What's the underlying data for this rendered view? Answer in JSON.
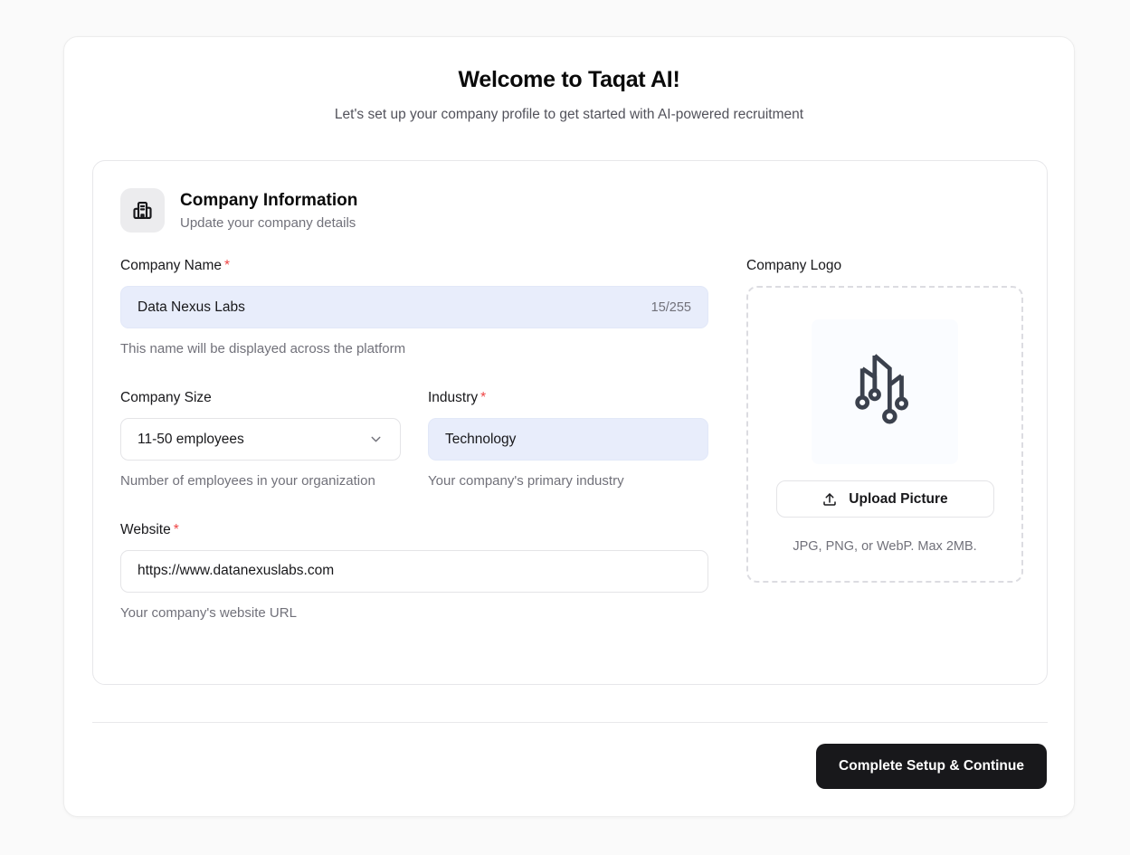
{
  "header": {
    "title": "Welcome to Taqat AI!",
    "subtitle": "Let's set up your company profile to get started with AI-powered recruitment"
  },
  "section": {
    "title": "Company Information",
    "subtitle": "Update your company details",
    "icon": "building-icon"
  },
  "form": {
    "company_name": {
      "label": "Company Name",
      "required": "*",
      "value": "Data Nexus Labs",
      "counter": "15/255",
      "helper": "This name will be displayed across the platform"
    },
    "company_size": {
      "label": "Company Size",
      "value": "11-50 employees",
      "helper": "Number of employees in your organization",
      "icon": "chevron-down-icon"
    },
    "industry": {
      "label": "Industry",
      "required": "*",
      "value": "Technology",
      "helper": "Your company's primary industry"
    },
    "website": {
      "label": "Website",
      "required": "*",
      "value": "https://www.datanexuslabs.com",
      "helper": "Your company's website URL"
    }
  },
  "logo": {
    "label": "Company Logo",
    "image_name": "data-nexus-labs-logo",
    "upload_button": "Upload Picture",
    "upload_icon": "upload-icon",
    "hint": "JPG, PNG, or WebP. Max 2MB."
  },
  "footer": {
    "submit_label": "Complete Setup & Continue"
  },
  "colors": {
    "filled_input_bg": "#e8edfb",
    "submit_button_bg": "#18181b",
    "required_marker": "#ef4444",
    "logo_stroke": "#3b414d"
  }
}
